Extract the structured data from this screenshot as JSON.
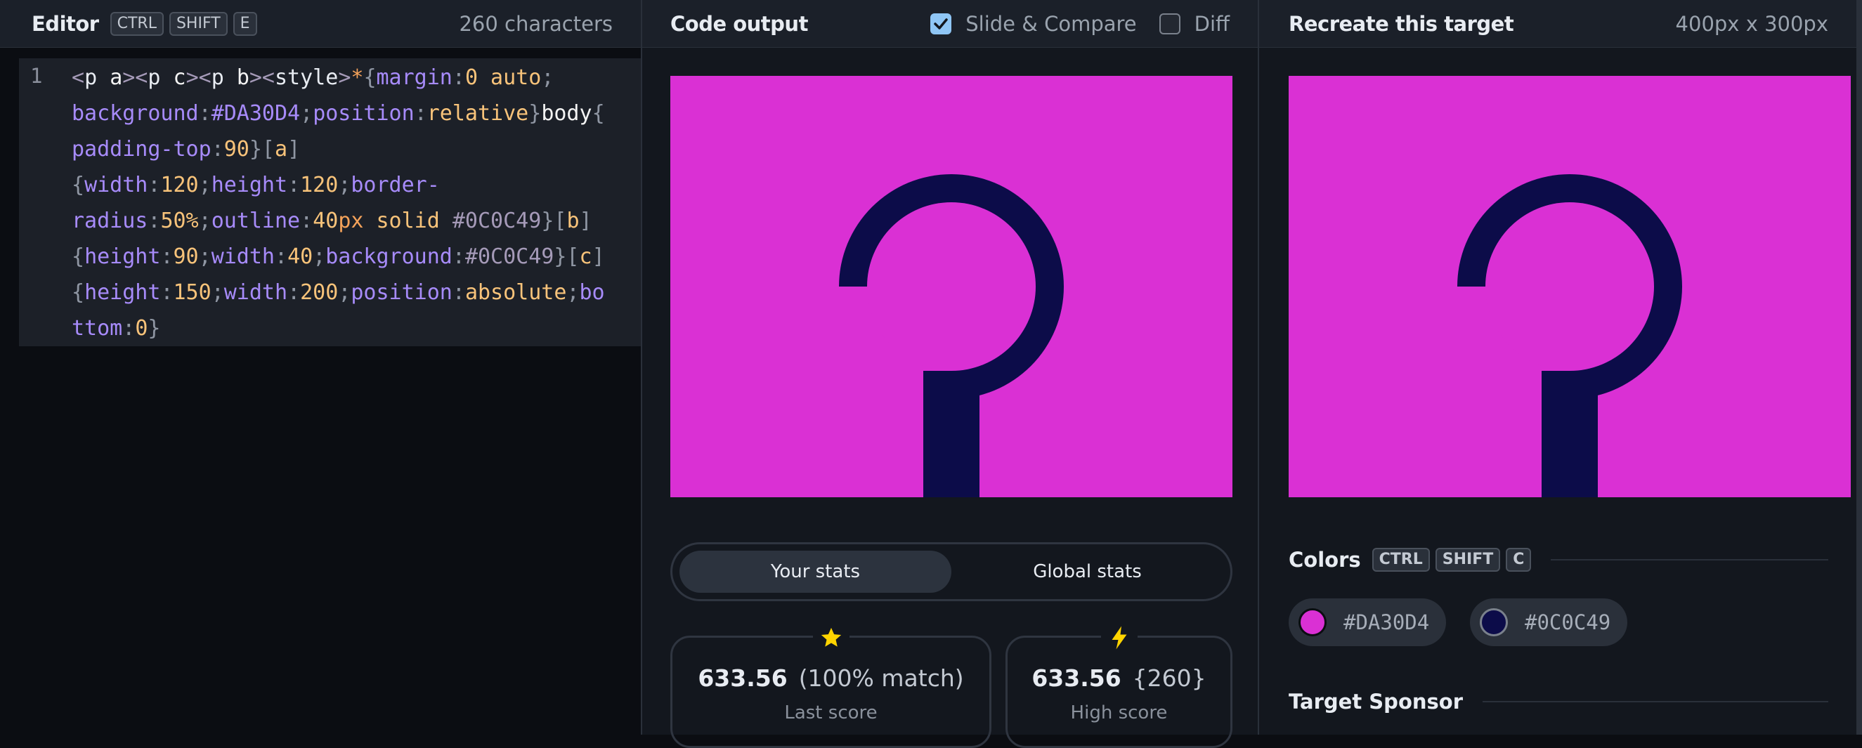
{
  "editor": {
    "title": "Editor",
    "shortcut": [
      "CTRL",
      "SHIFT",
      "E"
    ],
    "char_count": "260 characters",
    "line_number": "1"
  },
  "output": {
    "title": "Code output",
    "slide_compare_label": "Slide & Compare",
    "slide_compare_checked": true,
    "diff_label": "Diff",
    "diff_checked": false,
    "tabs": [
      "Your stats",
      "Global stats"
    ],
    "stats": [
      {
        "icon": "star-icon",
        "value": "633.56",
        "detail": "(100% match)",
        "label": "Last score"
      },
      {
        "icon": "lightning-icon",
        "value": "633.56",
        "detail": "{260}",
        "label": "High score"
      }
    ]
  },
  "target": {
    "title": "Recreate this target",
    "dimensions": "400px x 300px",
    "colors_title": "Colors",
    "colors_shortcut": [
      "CTRL",
      "SHIFT",
      "C"
    ],
    "colors": [
      "#DA30D4",
      "#0C0C49"
    ],
    "sponsor_title": "Target Sponsor"
  },
  "palette": {
    "accent": "#DA30D4",
    "dark": "#0C0C49",
    "check": "#8fc6f5",
    "star": "#ffd400"
  }
}
